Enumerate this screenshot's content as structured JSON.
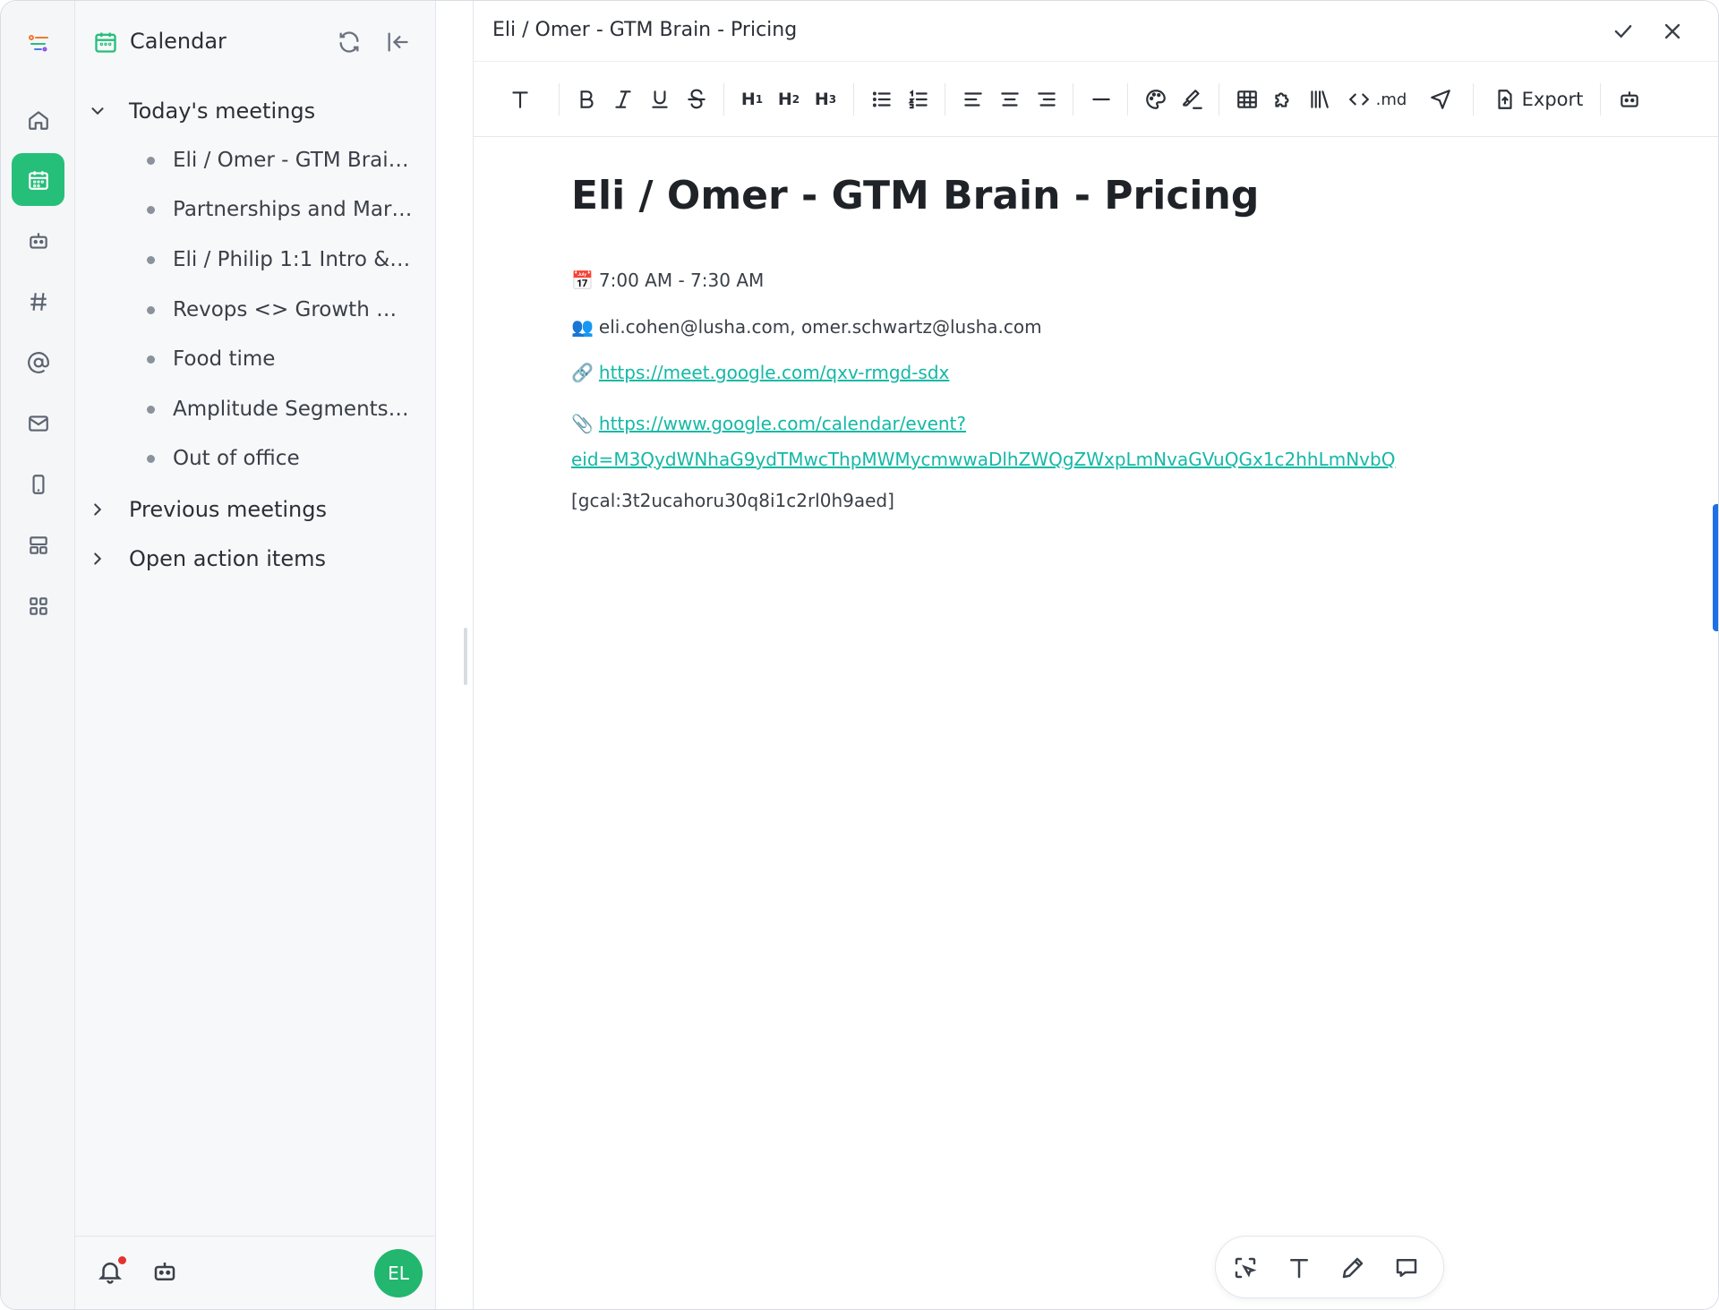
{
  "sidebar": {
    "title": "Calendar",
    "sections": {
      "today": "Today's meetings",
      "previous": "Previous meetings",
      "actions": "Open action items"
    },
    "meetings": [
      "Eli / Omer - GTM Brain ...",
      "Partnerships and Mark...",
      "Eli / Philip 1:1 Intro & W...",
      "Revops <> Growth <> ...",
      "Food time",
      "Amplitude Segments ...",
      "Out of office"
    ],
    "avatar_initials": "EL"
  },
  "doc": {
    "tab_title": "Eli / Omer - GTM Brain - Pricing",
    "title": "Eli / Omer - GTM Brain - Pricing",
    "time": "7:00 AM - 7:30 AM",
    "attendees": "eli.cohen@lusha.com, omer.schwartz@lusha.com",
    "meet_link": "https://meet.google.com/qxv-rmgd-sdx",
    "event_link_1": "https://www.google.com/calendar/event?",
    "event_link_2": "eid=M3QydWNhaG9ydTMwcThpMWMycmwwaDlhZWQgZWxpLmNvaGVuQGx1c2hhLmNvbQ",
    "gcal_id": "[gcal:3t2ucahoru30q8i1c2rl0h9aed]"
  },
  "toolbar": {
    "h1": "H",
    "h2": "H",
    "h3": "H",
    "h1_sub": "1",
    "h2_sub": "2",
    "h3_sub": "3",
    "md_label": ".md",
    "export_label": "Export"
  },
  "emoji": {
    "calendar": "📅",
    "people": "👥",
    "link": "🔗",
    "clip": "📎"
  },
  "colors": {
    "accent": "#26bf7a",
    "link": "#14b8a6",
    "scroll_accent": "#1f6fe6"
  }
}
